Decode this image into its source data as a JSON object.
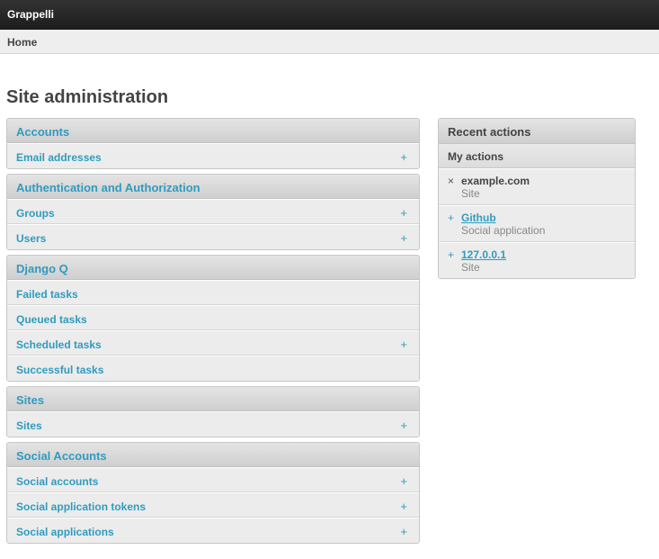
{
  "header": {
    "brand": "Grappelli"
  },
  "breadcrumb": {
    "home": "Home"
  },
  "page": {
    "title": "Site administration"
  },
  "modules": [
    {
      "title": "Accounts",
      "rows": [
        {
          "label": "Email addresses",
          "add": "+"
        }
      ]
    },
    {
      "title": "Authentication and Authorization",
      "rows": [
        {
          "label": "Groups",
          "add": "+"
        },
        {
          "label": "Users",
          "add": "+"
        }
      ]
    },
    {
      "title": "Django Q",
      "rows": [
        {
          "label": "Failed tasks",
          "add": ""
        },
        {
          "label": "Queued tasks",
          "add": ""
        },
        {
          "label": "Scheduled tasks",
          "add": "+"
        },
        {
          "label": "Successful tasks",
          "add": ""
        }
      ]
    },
    {
      "title": "Sites",
      "rows": [
        {
          "label": "Sites",
          "add": "+"
        }
      ]
    },
    {
      "title": "Social Accounts",
      "rows": [
        {
          "label": "Social accounts",
          "add": "+"
        },
        {
          "label": "Social application tokens",
          "add": "+"
        },
        {
          "label": "Social applications",
          "add": "+"
        }
      ]
    }
  ],
  "recent": {
    "title": "Recent actions",
    "subtitle": "My actions",
    "items": [
      {
        "icon": "delete-icon",
        "glyph": "×",
        "name": "example.com",
        "type": "Site"
      },
      {
        "icon": "add-icon",
        "glyph": "+",
        "name": "Github",
        "type": "Social application"
      },
      {
        "icon": "add-icon",
        "glyph": "+",
        "name": "127.0.0.1",
        "type": "Site"
      }
    ]
  }
}
